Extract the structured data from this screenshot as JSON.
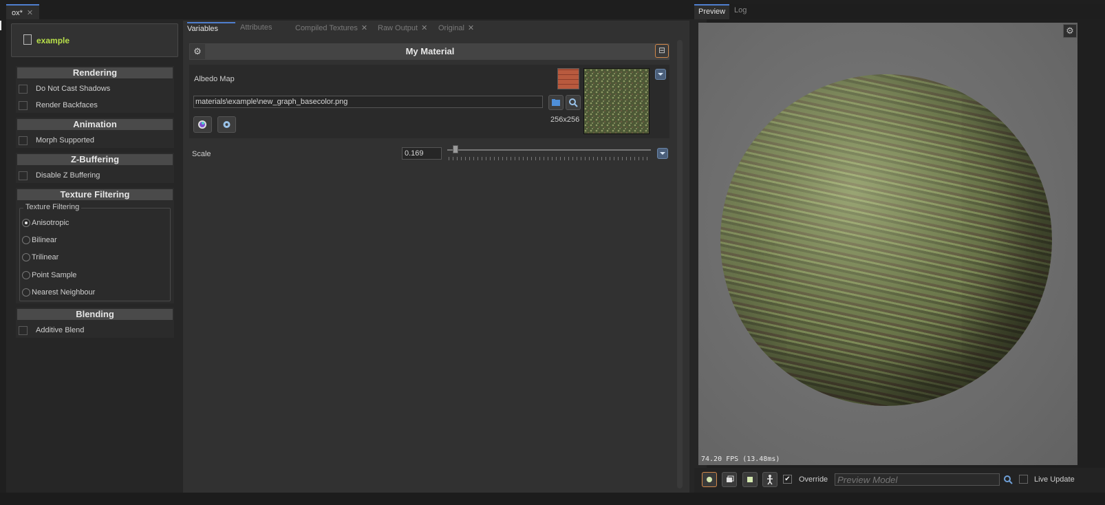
{
  "document_tab": {
    "label": "ox*",
    "close": "✕"
  },
  "material_name": "example",
  "sections": {
    "rendering": {
      "title": "Rendering",
      "items": [
        "Do Not Cast Shadows",
        "Render Backfaces"
      ]
    },
    "animation": {
      "title": "Animation",
      "items": [
        "Morph Supported"
      ]
    },
    "zbuffering": {
      "title": "Z-Buffering",
      "items": [
        "Disable Z Buffering"
      ]
    },
    "texture_filtering": {
      "title": "Texture Filtering",
      "group_title": "Texture Filtering",
      "options": [
        "Anisotropic",
        "Bilinear",
        "Trilinear",
        "Point Sample",
        "Nearest Neighbour"
      ],
      "selected": "Anisotropic"
    },
    "blending": {
      "title": "Blending",
      "items": [
        "Additive Blend"
      ]
    }
  },
  "center_tabs": [
    {
      "label": "Variables",
      "active": true
    },
    {
      "label": "Attributes"
    },
    {
      "label": "Compiled Textures",
      "close": "✕"
    },
    {
      "label": "Raw Output",
      "close": "✕"
    },
    {
      "label": "Original",
      "close": "✕"
    }
  ],
  "material_header": {
    "title": "My Material",
    "gear": "⚙",
    "collapse": "⊟"
  },
  "albedo": {
    "label": "Albedo Map",
    "path": "materials\\example\\new_graph_basecolor.png",
    "size": "256x256"
  },
  "scale": {
    "label": "Scale",
    "value": "0.169",
    "fraction": 0.05
  },
  "preview_tabs": [
    {
      "label": "Preview",
      "active": true
    },
    {
      "label": "Log"
    }
  ],
  "fps": "74.20 FPS (13.48ms)",
  "bottom": {
    "override_label": "Override",
    "override_checked": true,
    "model_placeholder": "Preview Model",
    "live_update_label": "Live Update"
  },
  "colors": {
    "accent": "#4f7fd0",
    "material_name": "#b8e04a",
    "selected_border": "#d2884a"
  }
}
